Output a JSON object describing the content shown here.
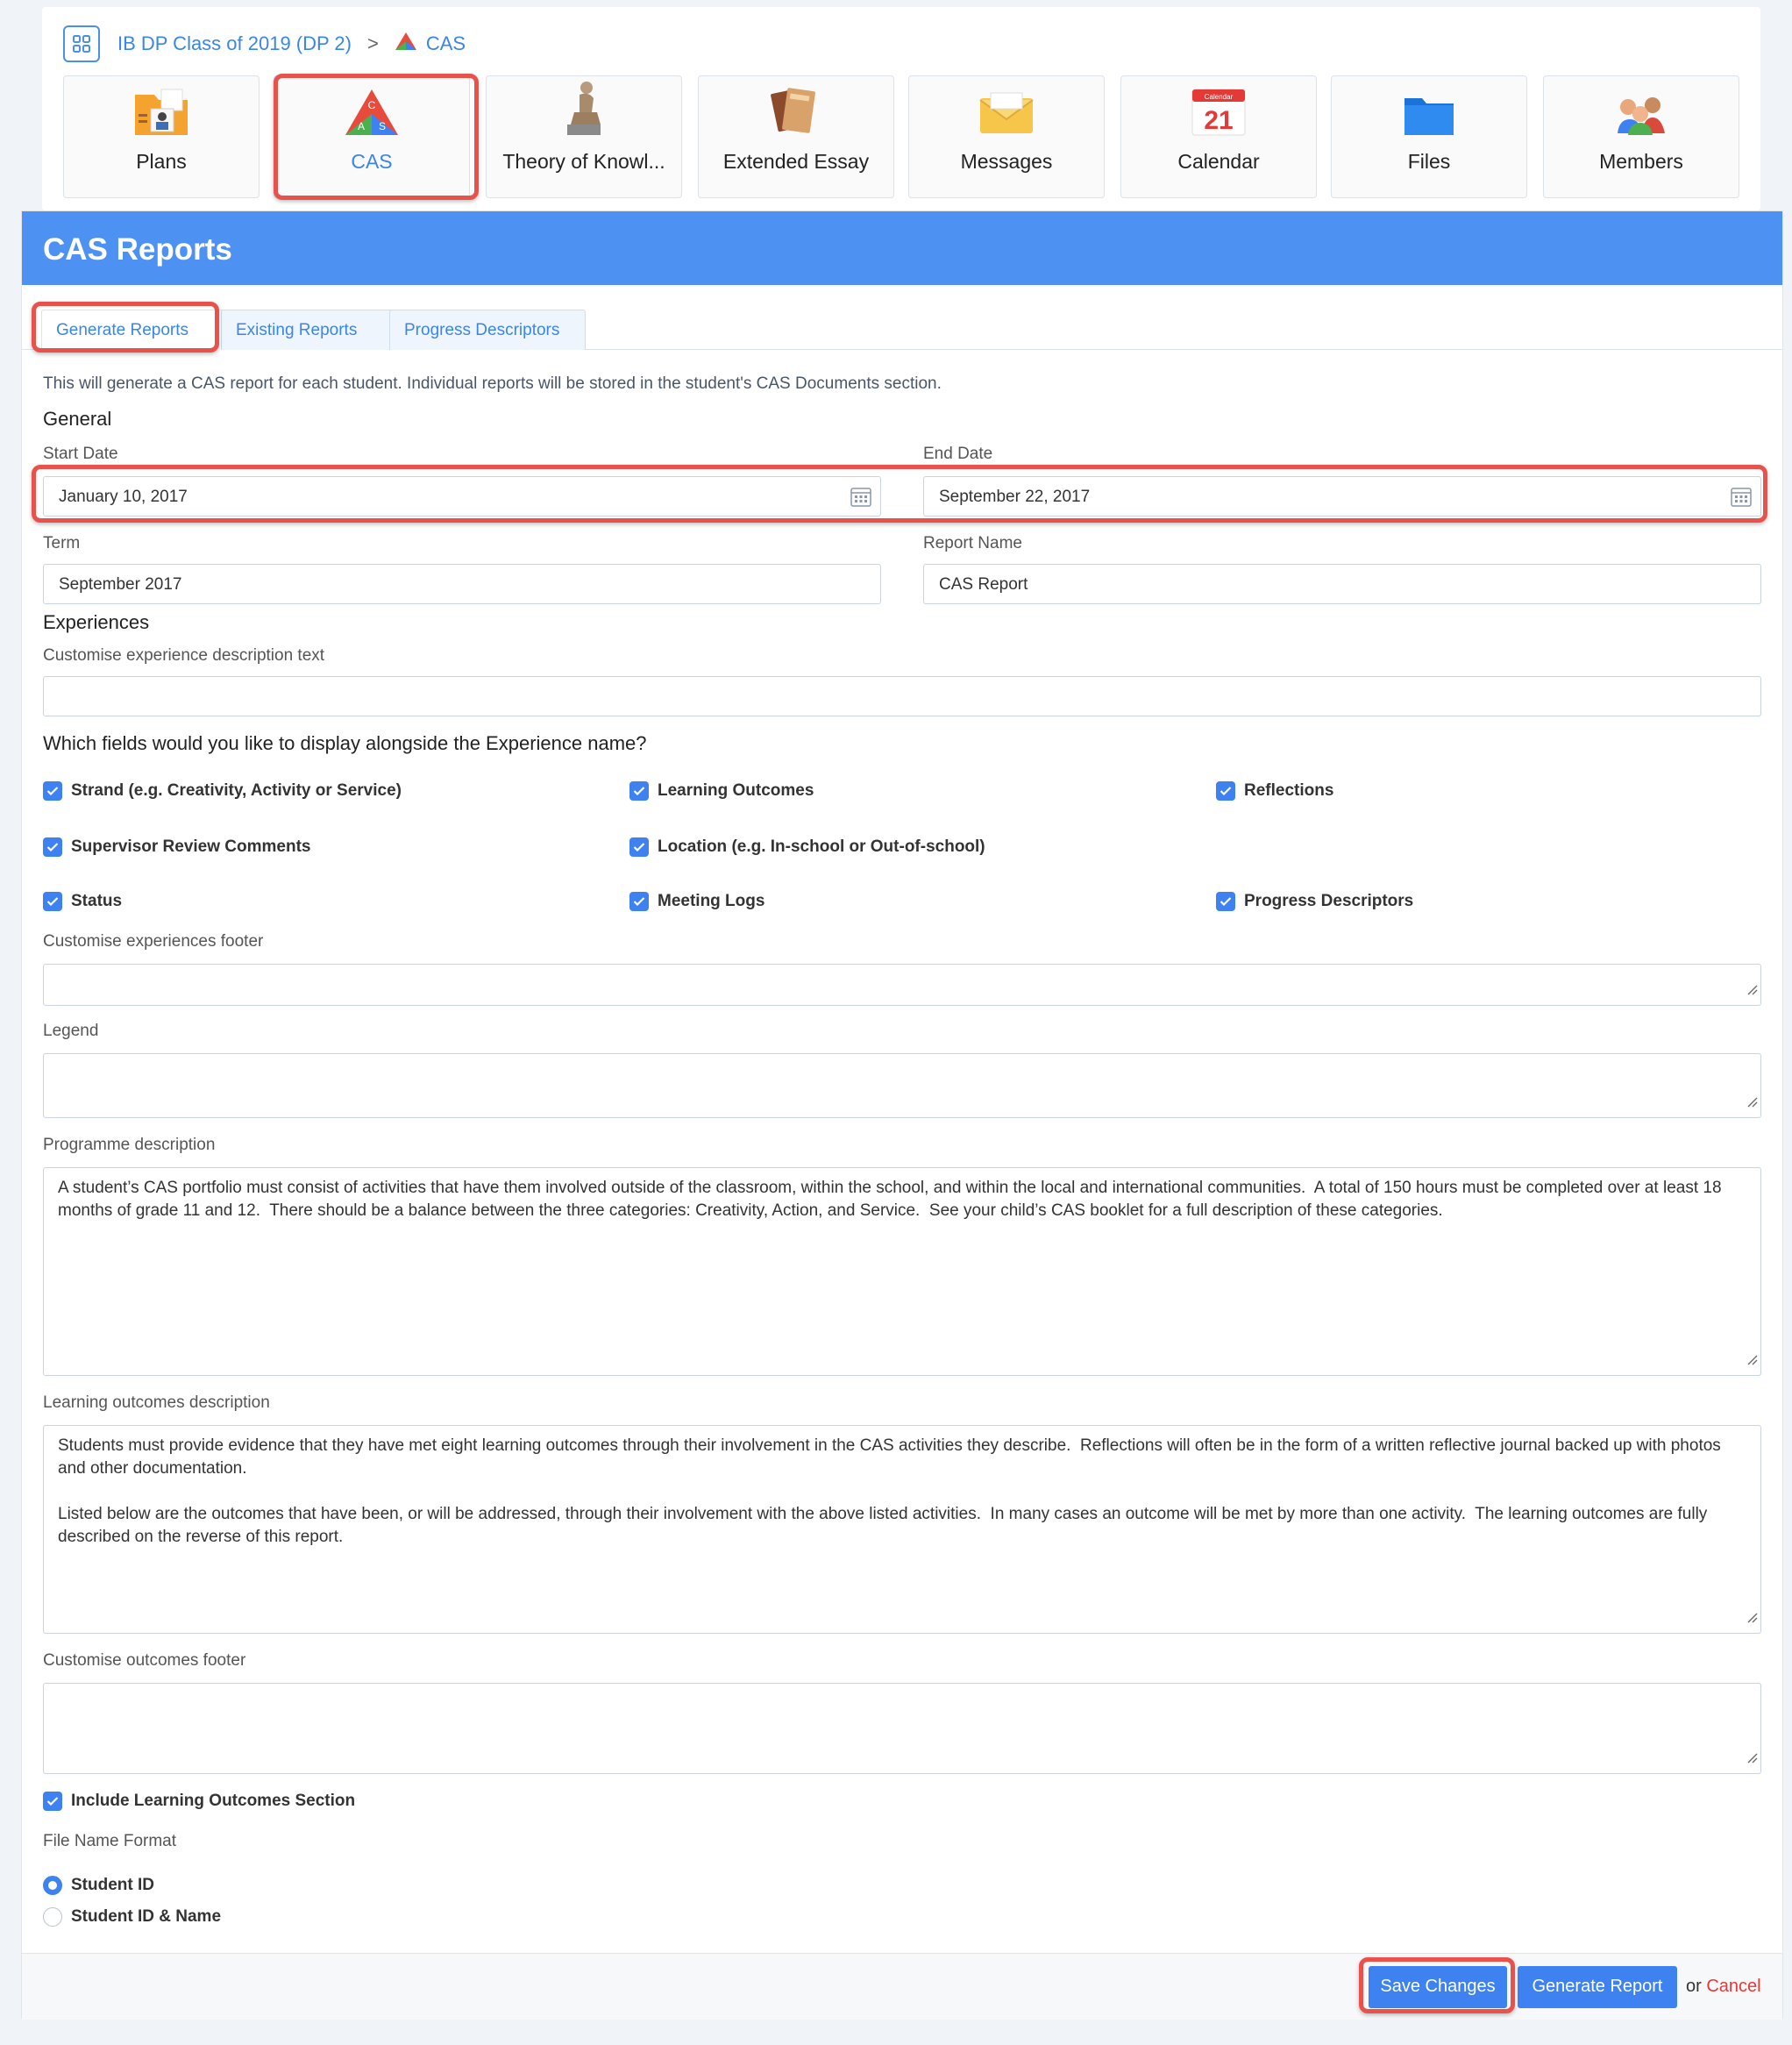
{
  "breadcrumb": {
    "class_name": "IB DP Class of 2019 (DP 2)",
    "separator": ">",
    "current": "CAS"
  },
  "tiles": [
    {
      "label": "Plans",
      "icon": "plans-folder-icon"
    },
    {
      "label": "CAS",
      "icon": "cas-triangle-icon"
    },
    {
      "label": "Theory of Knowl...",
      "icon": "thinker-statue-icon"
    },
    {
      "label": "Extended Essay",
      "icon": "books-icon"
    },
    {
      "label": "Messages",
      "icon": "envelope-icon"
    },
    {
      "label": "Calendar",
      "icon": "calendar-icon",
      "calendar_day": "21",
      "calendar_caption": "Calendar"
    },
    {
      "label": "Files",
      "icon": "folder-icon"
    },
    {
      "label": "Members",
      "icon": "people-group-icon"
    }
  ],
  "cas_icon_letters": {
    "c": "C",
    "a": "A",
    "s": "S"
  },
  "panel": {
    "title": "CAS Reports"
  },
  "tabs": [
    "Generate Reports",
    "Existing Reports",
    "Progress Descriptors"
  ],
  "intro": "This will generate a CAS report for each student. Individual reports will be stored in the student's CAS Documents section.",
  "general": {
    "heading": "General",
    "start_date_label": "Start Date",
    "start_date": "January 10, 2017",
    "end_date_label": "End Date",
    "end_date": "September 22, 2017",
    "term_label": "Term",
    "term": "September 2017",
    "report_name_label": "Report Name",
    "report_name": "CAS Report"
  },
  "experiences": {
    "heading": "Experiences",
    "desc_label": "Customise experience description text",
    "desc_value": "",
    "fields_question": "Which fields would you like to display alongside the Experience name?",
    "checkboxes": [
      "Strand (e.g. Creativity, Activity or Service)",
      "Learning Outcomes",
      "Reflections",
      "Supervisor Review Comments",
      "Location (e.g. In-school or Out-of-school)",
      "Status",
      "Meeting Logs",
      "Progress Descriptors"
    ],
    "footer_label": "Customise experiences footer",
    "footer_value": ""
  },
  "legend": {
    "label": "Legend",
    "value": ""
  },
  "programme": {
    "label": "Programme description",
    "value": "A student’s CAS portfolio must consist of activities that have them involved outside of the classroom, within the school, and within the local and international communities.  A total of 150 hours must be completed over at least 18 months of grade 11 and 12.  There should be a balance between the three categories: Creativity, Action, and Service.  See your child’s CAS booklet for a full description of these categories."
  },
  "outcomes": {
    "label": "Learning outcomes description",
    "value": "Students must provide evidence that they have met eight learning outcomes through their involvement in the CAS activities they describe.  Reflections will often be in the form of a written reflective journal backed up with photos and other documentation.\n\nListed below are the outcomes that have been, or will be addressed, through their involvement with the above listed activities.  In many cases an outcome will be met by more than one activity.  The learning outcomes are fully described on the reverse of this report.",
    "footer_label": "Customise outcomes footer",
    "footer_value": ""
  },
  "include_outcomes": "Include Learning Outcomes Section",
  "file_name": {
    "label": "File Name Format",
    "options": [
      "Student ID",
      "Student ID & Name"
    ],
    "selected": "Student ID"
  },
  "footer": {
    "save": "Save Changes",
    "generate": "Generate Report",
    "or": "or",
    "cancel": "Cancel"
  },
  "colors": {
    "accent": "#3d82f0",
    "header": "#4d92f2",
    "highlight": "#e9524a",
    "cancel": "#e53935"
  }
}
